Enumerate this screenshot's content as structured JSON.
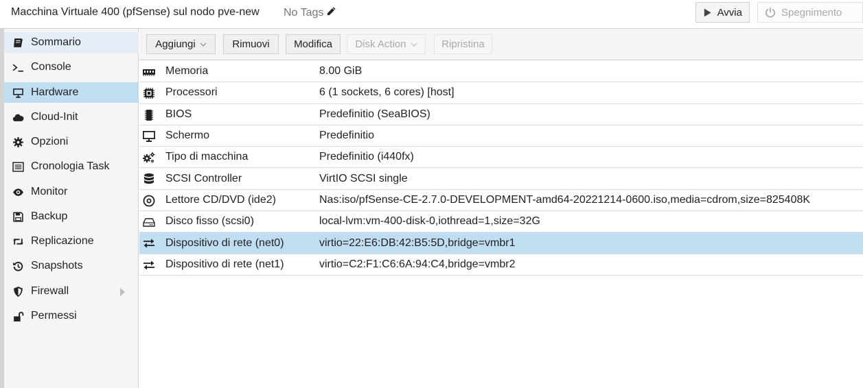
{
  "header": {
    "title": "Macchina Virtuale 400 (pfSense) sul nodo pve-new",
    "tags": "No Tags",
    "start_label": "Avvia",
    "shutdown_label": "Spegnimento"
  },
  "sidebar": {
    "items": [
      {
        "label": "Sommario",
        "icon": "book-icon"
      },
      {
        "label": "Console",
        "icon": "terminal-icon"
      },
      {
        "label": "Hardware",
        "icon": "desktop-icon"
      },
      {
        "label": "Cloud-Init",
        "icon": "cloud-icon"
      },
      {
        "label": "Opzioni",
        "icon": "gear-icon"
      },
      {
        "label": "Cronologia Task",
        "icon": "list-icon"
      },
      {
        "label": "Monitor",
        "icon": "eye-icon"
      },
      {
        "label": "Backup",
        "icon": "floppy-icon"
      },
      {
        "label": "Replicazione",
        "icon": "retweet-icon"
      },
      {
        "label": "Snapshots",
        "icon": "history-icon"
      },
      {
        "label": "Firewall",
        "icon": "shield-icon"
      },
      {
        "label": "Permessi",
        "icon": "unlock-icon"
      }
    ],
    "active": "Hardware"
  },
  "toolbar": {
    "add_label": "Aggiungi",
    "remove_label": "Rimuovi",
    "edit_label": "Modifica",
    "disk_action_label": "Disk Action",
    "restore_label": "Ripristina"
  },
  "hardware": {
    "rows": [
      {
        "name": "Memoria",
        "value": "8.00 GiB",
        "icon": "memory-icon"
      },
      {
        "name": "Processori",
        "value": "6 (1 sockets, 6 cores) [host]",
        "icon": "cpu-icon"
      },
      {
        "name": "BIOS",
        "value": "Predefinitio (SeaBIOS)",
        "icon": "microchip-icon"
      },
      {
        "name": "Schermo",
        "value": "Predefinitio",
        "icon": "monitor-icon"
      },
      {
        "name": "Tipo di macchina",
        "value": "Predefinitio (i440fx)",
        "icon": "cogs-icon"
      },
      {
        "name": "SCSI Controller",
        "value": "VirtIO SCSI single",
        "icon": "database-icon"
      },
      {
        "name": "Lettore CD/DVD (ide2)",
        "value": "Nas:iso/pfSense-CE-2.7.0-DEVELOPMENT-amd64-20221214-0600.iso,media=cdrom,size=825408K",
        "icon": "cdrom-icon"
      },
      {
        "name": "Disco fisso (scsi0)",
        "value": "local-lvm:vm-400-disk-0,iothread=1,size=32G",
        "icon": "harddisk-icon"
      },
      {
        "name": "Dispositivo di rete (net0)",
        "value": "virtio=22:E6:DB:42:B5:5D,bridge=vmbr1",
        "icon": "exchange-icon"
      },
      {
        "name": "Dispositivo di rete (net1)",
        "value": "virtio=C2:F1:C6:6A:94:C4,bridge=vmbr2",
        "icon": "exchange-icon"
      }
    ],
    "selected": "Dispositivo di rete (net0)"
  }
}
